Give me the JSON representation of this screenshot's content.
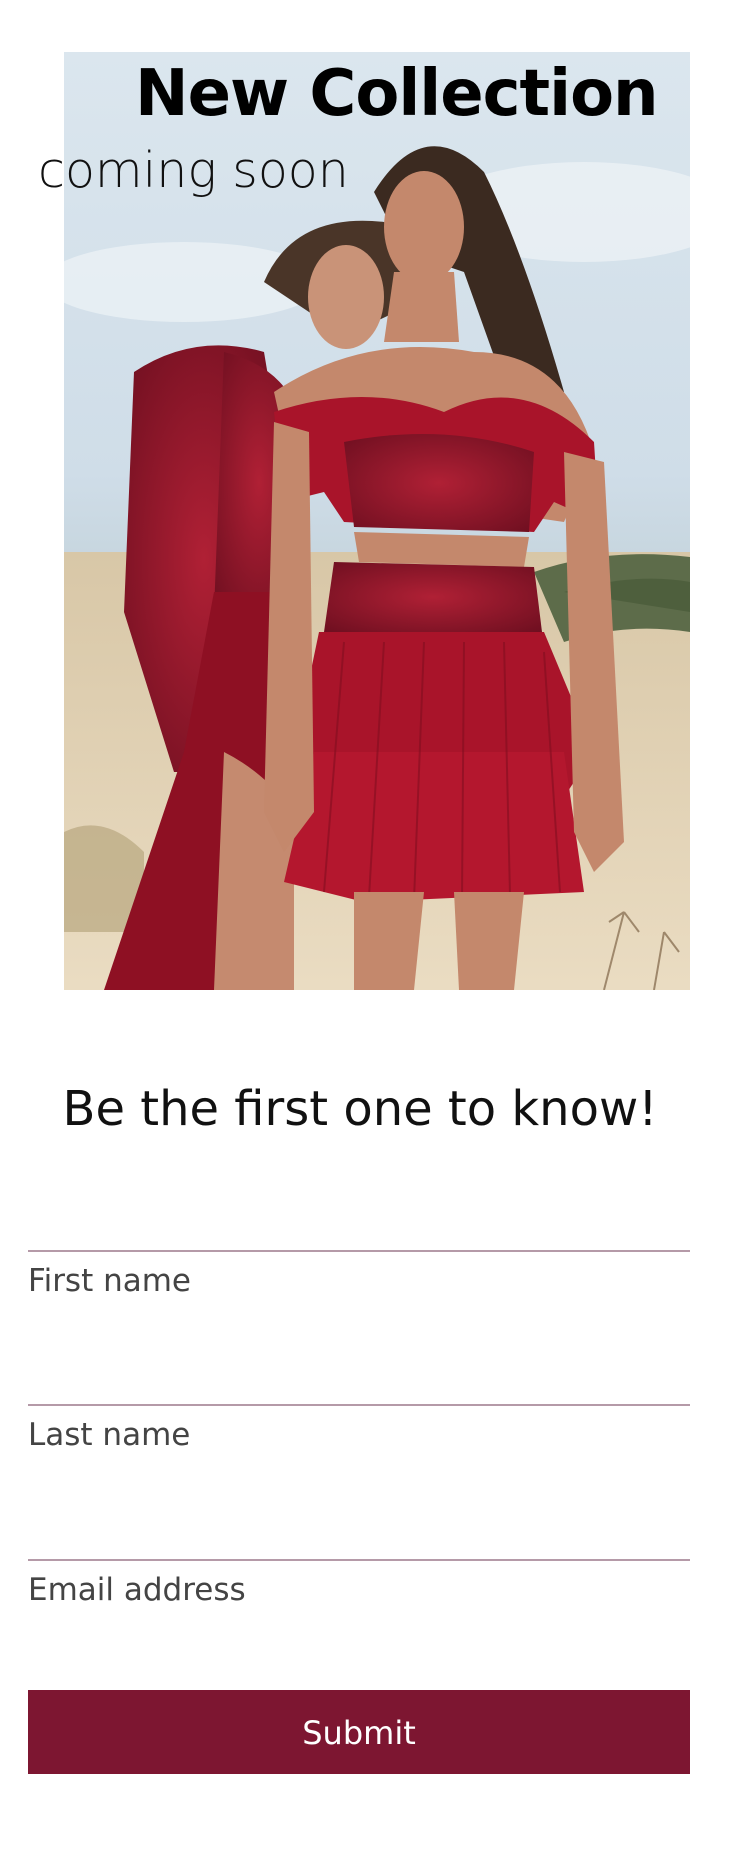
{
  "hero": {
    "headline": "New Collection",
    "subhead": "coming soon"
  },
  "form": {
    "title": "Be the first one to know!",
    "first_name_label": "First name",
    "last_name_label": "Last name",
    "email_label": "Email address",
    "submit_label": "Submit"
  },
  "colors": {
    "accent": "#7d1631",
    "field_line": "#b59aa8",
    "dress_red": "#a9142a"
  }
}
